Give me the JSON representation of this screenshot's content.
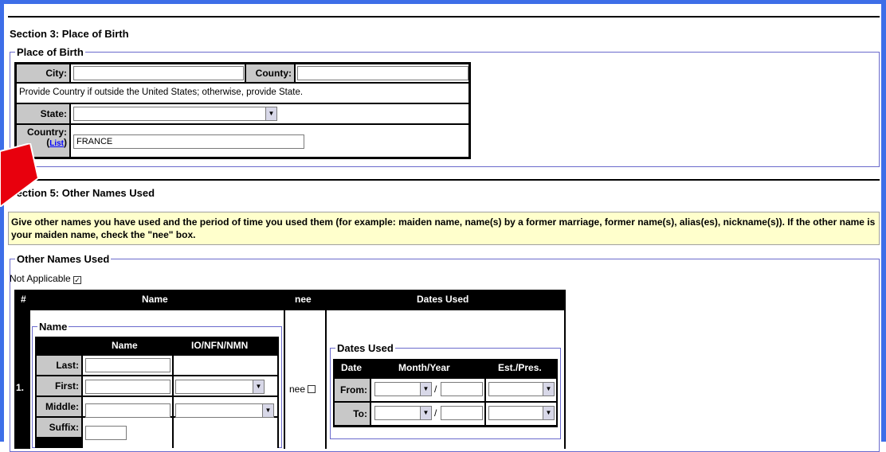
{
  "section3": {
    "title": "Section 3: Place of Birth",
    "legend": "Place of Birth",
    "city_label": "City:",
    "city_value": "",
    "county_label": "County:",
    "county_value": "",
    "instruction": "Provide Country if outside the United States; otherwise, provide State.",
    "state_label": "State:",
    "state_value": "",
    "country_label": "Country:",
    "country_link": "List",
    "country_value": "FRANCE"
  },
  "section5": {
    "title": "Section 5: Other Names Used",
    "info": "Give other names you have used and the period of time you used them (for example: maiden name, name(s) by a former marriage, former name(s), alias(es), nickname(s)). If the other name is your maiden name, check the \"nee\" box.",
    "legend": "Other Names Used",
    "not_applicable_label": "Not Applicable",
    "not_applicable_checked": true,
    "table_headers": {
      "num": "#",
      "name": "Name",
      "nee": "nee",
      "dates": "Dates Used"
    },
    "row_number": "1.",
    "name_legend": "Name",
    "name_headers": {
      "name": "Name",
      "suffix_col": "IO/NFN/NMN"
    },
    "last_label": "Last:",
    "first_label": "First:",
    "middle_label": "Middle:",
    "suffix_label": "Suffix:",
    "nee_label": "nee",
    "dates_legend": "Dates Used",
    "dates_headers": {
      "date": "Date",
      "month_year": "Month/Year",
      "est": "Est./Pres."
    },
    "from_label": "From:",
    "to_label": "To:",
    "slash": "/"
  },
  "colors": {
    "frame": "#3d6ee8",
    "label_bg": "#c8c8c8",
    "info_bg": "#ffffcc",
    "arrow": "#e8000d"
  }
}
